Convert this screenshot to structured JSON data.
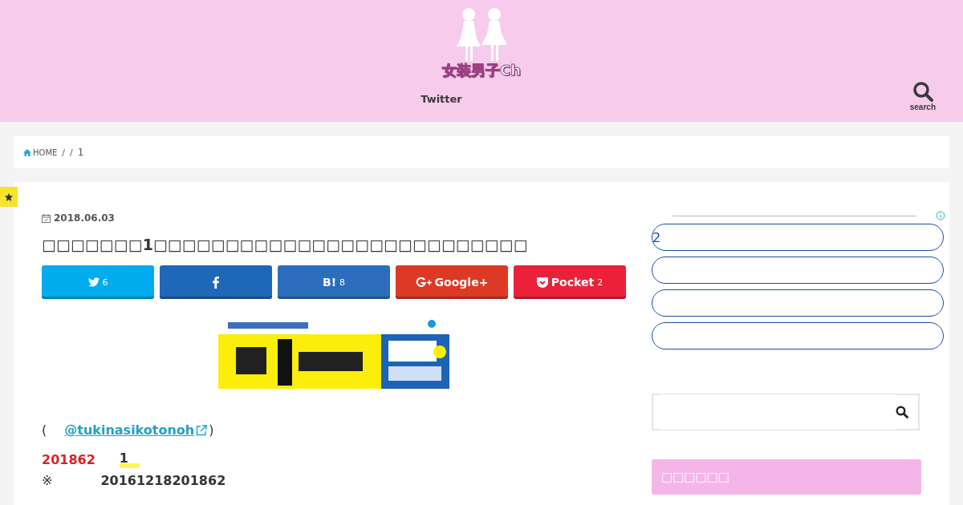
{
  "header": {
    "logo_text": "女装男子Ch",
    "nav": [
      {
        "label": "Twitter"
      }
    ],
    "search_label": "search"
  },
  "breadcrumb": [
    {
      "label": "HOME",
      "kind": "home"
    },
    {
      "label": "/",
      "kind": "sep"
    },
    {
      "label": "/",
      "kind": "sep"
    },
    {
      "label": "1",
      "kind": "current"
    }
  ],
  "article": {
    "date": "2018.06.03",
    "title": "□□□□□□□1□□□□□□□□□□□□□□□□□□□□□□□□□□",
    "share": [
      {
        "kind": "twitter",
        "count": "6",
        "color": "#00acee"
      },
      {
        "kind": "facebook",
        "color": "#1f68b7"
      },
      {
        "kind": "hatena",
        "label": "B!",
        "count": "8",
        "color": "#2c6ebd"
      },
      {
        "kind": "google",
        "label": "Google+",
        "color": "#dd3a26"
      },
      {
        "kind": "pocket",
        "label": "Pocket",
        "count": "2",
        "color": "#eb2139"
      }
    ],
    "source": {
      "open": "(",
      "link": "@tukinasikotonoh",
      "close": ")"
    },
    "lines": [
      {
        "kind": "highlight",
        "lead": "201862",
        "text": "1"
      },
      {
        "kind": "note",
        "lead": "※",
        "text": "20161218201862"
      }
    ]
  },
  "sidebar": {
    "pills": [
      {
        "label": "2"
      }
    ],
    "heading": "□□□□□□"
  }
}
